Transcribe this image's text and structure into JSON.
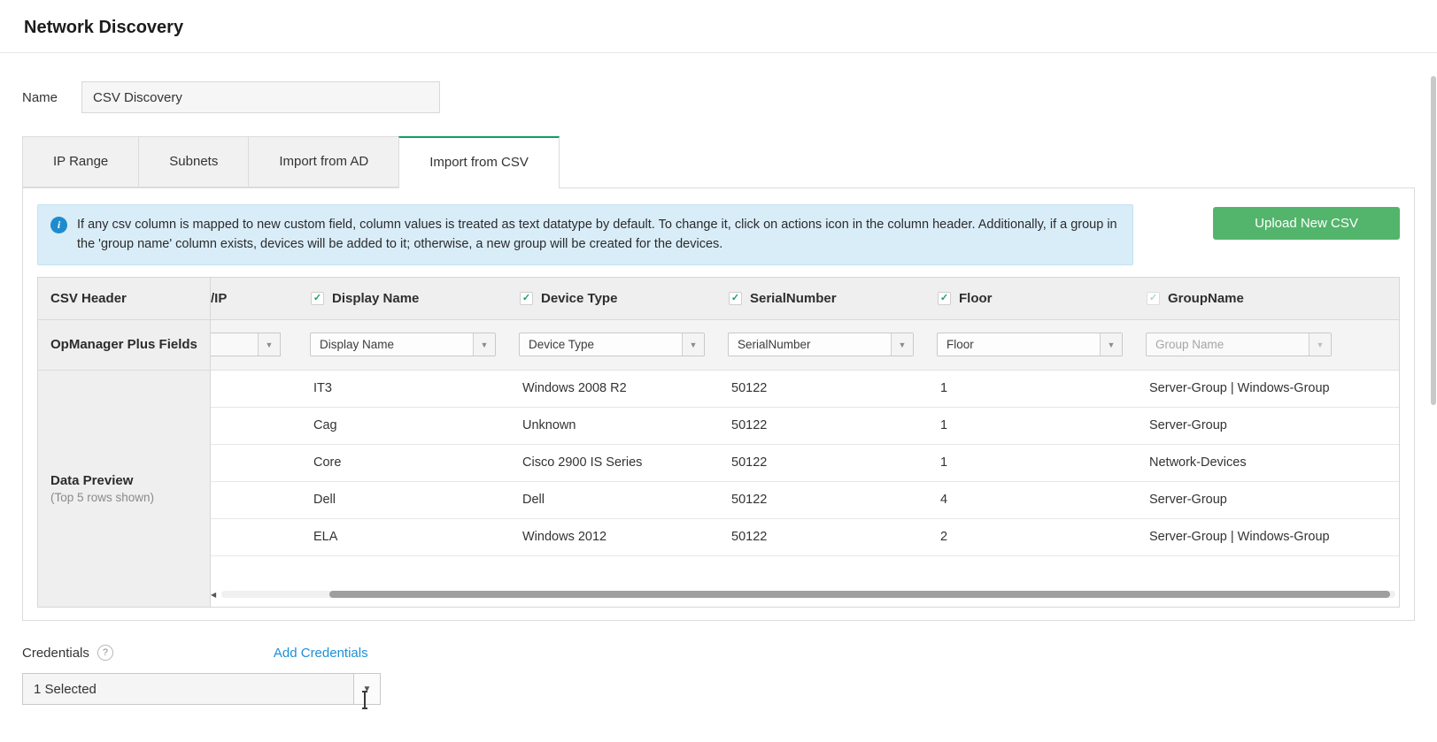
{
  "page": {
    "title": "Network Discovery"
  },
  "name_field": {
    "label": "Name",
    "value": "CSV Discovery"
  },
  "tabs": [
    {
      "label": "IP Range"
    },
    {
      "label": "Subnets"
    },
    {
      "label": "Import from AD"
    },
    {
      "label": "Import from CSV"
    }
  ],
  "active_tab": "Import from CSV",
  "info_banner": {
    "text": "If any csv column is mapped to new custom field, column values is treated as text datatype by default. To change it, click on actions icon in the column header. Additionally, if a group in the 'group name' column exists, devices will be added to it; otherwise, a new group will be created for the devices."
  },
  "upload_button": {
    "label": "Upload New CSV"
  },
  "mapping_table": {
    "row_labels": {
      "csv_header": "CSV Header",
      "opmanager_fields": "OpManager Plus Fields",
      "data_preview": "Data Preview",
      "data_preview_note": "(Top 5 rows shown)"
    },
    "columns": [
      {
        "header": "/IP",
        "dropdown": ""
      },
      {
        "header": "Display Name",
        "dropdown": "Display Name"
      },
      {
        "header": "Device Type",
        "dropdown": "Device Type"
      },
      {
        "header": "SerialNumber",
        "dropdown": "SerialNumber"
      },
      {
        "header": "Floor",
        "dropdown": "Floor"
      },
      {
        "header": "GroupName",
        "dropdown": "Group Name"
      }
    ],
    "rows": [
      [
        "IT3",
        "Windows 2008 R2",
        "50122",
        "1",
        "Server-Group | Windows-Group"
      ],
      [
        "Cag",
        "Unknown",
        "50122",
        "1",
        "Server-Group"
      ],
      [
        "Core",
        "Cisco 2900 IS Series",
        "50122",
        "1",
        "Network-Devices"
      ],
      [
        "Dell",
        "Dell",
        "50122",
        "4",
        "Server-Group"
      ],
      [
        "ELA",
        "Windows 2012",
        "50122",
        "2",
        "Server-Group | Windows-Group"
      ]
    ]
  },
  "credentials": {
    "label": "Credentials",
    "add_link": "Add Credentials",
    "selected_value": "1 Selected"
  },
  "icons": {
    "info": "i",
    "check": "✓",
    "caret": "▼",
    "help": "?",
    "scroll_left": "◀"
  }
}
